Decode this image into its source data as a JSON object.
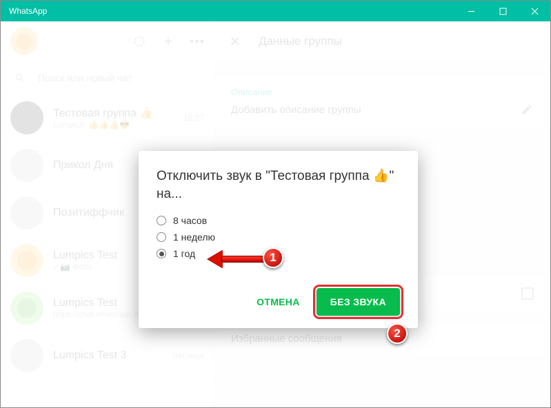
{
  "window": {
    "title": "WhatsApp"
  },
  "sidebar": {
    "search_placeholder": "Поиск или новый чат",
    "chats": [
      {
        "name": "Тестовая группа 👍",
        "sub": "Lumpics: 👍👍👍😎",
        "time": "16:27"
      },
      {
        "name": "Прикол Дня",
        "sub": "",
        "time": ""
      },
      {
        "name": "Позитиффчик",
        "sub": "",
        "time": ""
      },
      {
        "name": "Lumpics Test",
        "sub": "✓📷 Фото",
        "time": ""
      },
      {
        "name": "Lumpics Test",
        "sub": "https://chat.whatsapp.com/…",
        "time": ""
      },
      {
        "name": "Lumpics Test 3",
        "sub": "",
        "time": "пятница"
      }
    ]
  },
  "rightpane": {
    "header": "Данные группы",
    "desc_label": "Описание",
    "desc_placeholder": "Добавить описание группы",
    "starred": "Избранные сообщения"
  },
  "dialog": {
    "title_prefix": "Отключить звук в \"Тестовая группа ",
    "title_emoji": "👍",
    "title_suffix": "\" на...",
    "options": [
      "8 часов",
      "1 неделю",
      "1 год"
    ],
    "selected_index": 2,
    "cancel": "ОТМЕНА",
    "confirm": "БЕЗ ЗВУКА"
  },
  "markers": {
    "one": "1",
    "two": "2"
  }
}
